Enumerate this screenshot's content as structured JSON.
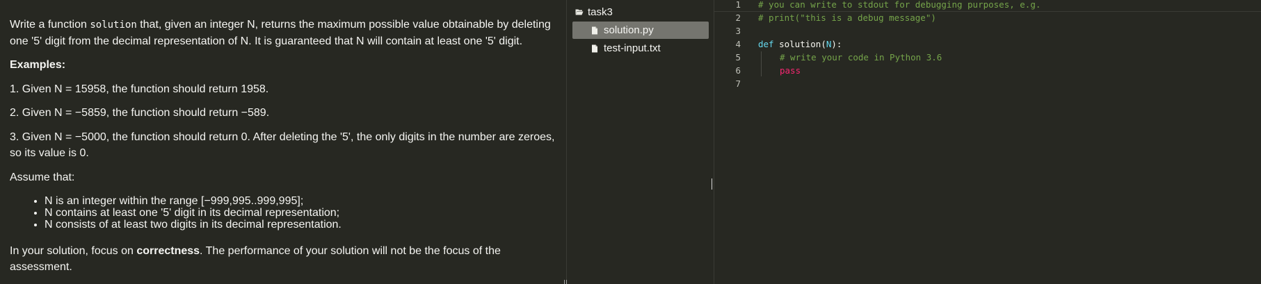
{
  "task": {
    "intro_prefix": "Write a function ",
    "intro_code": "solution",
    "intro_suffix": " that, given an integer N, returns the maximum possible value obtainable by deleting one '5' digit from the decimal representation of N. It is guaranteed that N will contain at least one '5' digit.",
    "examples_heading": "Examples:",
    "example_1": "1. Given N = 15958, the function should return 1958.",
    "example_2": "2. Given N = −5859, the function should return −589.",
    "example_3": "3. Given N = −5000, the function should return 0. After deleting the '5', the only digits in the number are zeroes, so its value is 0.",
    "assume_heading": "Assume that:",
    "constraints": [
      "N is an integer within the range [−999,995..999,995];",
      "N contains at least one '5' digit in its decimal representation;",
      "N consists of at least two digits in its decimal representation."
    ],
    "focus_prefix": "In your solution, focus on ",
    "focus_bold": "correctness",
    "focus_suffix": ". The performance of your solution will not be the focus of the assessment."
  },
  "file_tree": {
    "folder": {
      "label": "task3",
      "icon": "folder-open-icon"
    },
    "files": [
      {
        "label": "solution.py",
        "icon": "file-icon",
        "active": true
      },
      {
        "label": "test-input.txt",
        "icon": "file-icon",
        "active": false
      }
    ]
  },
  "editor": {
    "line_numbers": [
      "1",
      "2",
      "3",
      "4",
      "5",
      "6",
      "7"
    ],
    "lines": {
      "l1": "# you can write to stdout for debugging purposes, e.g.",
      "l2": "# print(\"this is a debug message\")",
      "l4_kw": "def",
      "l4_fn": "solution",
      "l4_open": "(",
      "l4_param": "N",
      "l4_close": "):",
      "l5": "# write your code in Python 3.6",
      "l6": "pass"
    }
  },
  "colors": {
    "background": "#272822",
    "active_file": "#75756f",
    "comment": "#75a44a",
    "keyword": "#66d9ef",
    "pass_keyword": "#f92672"
  }
}
